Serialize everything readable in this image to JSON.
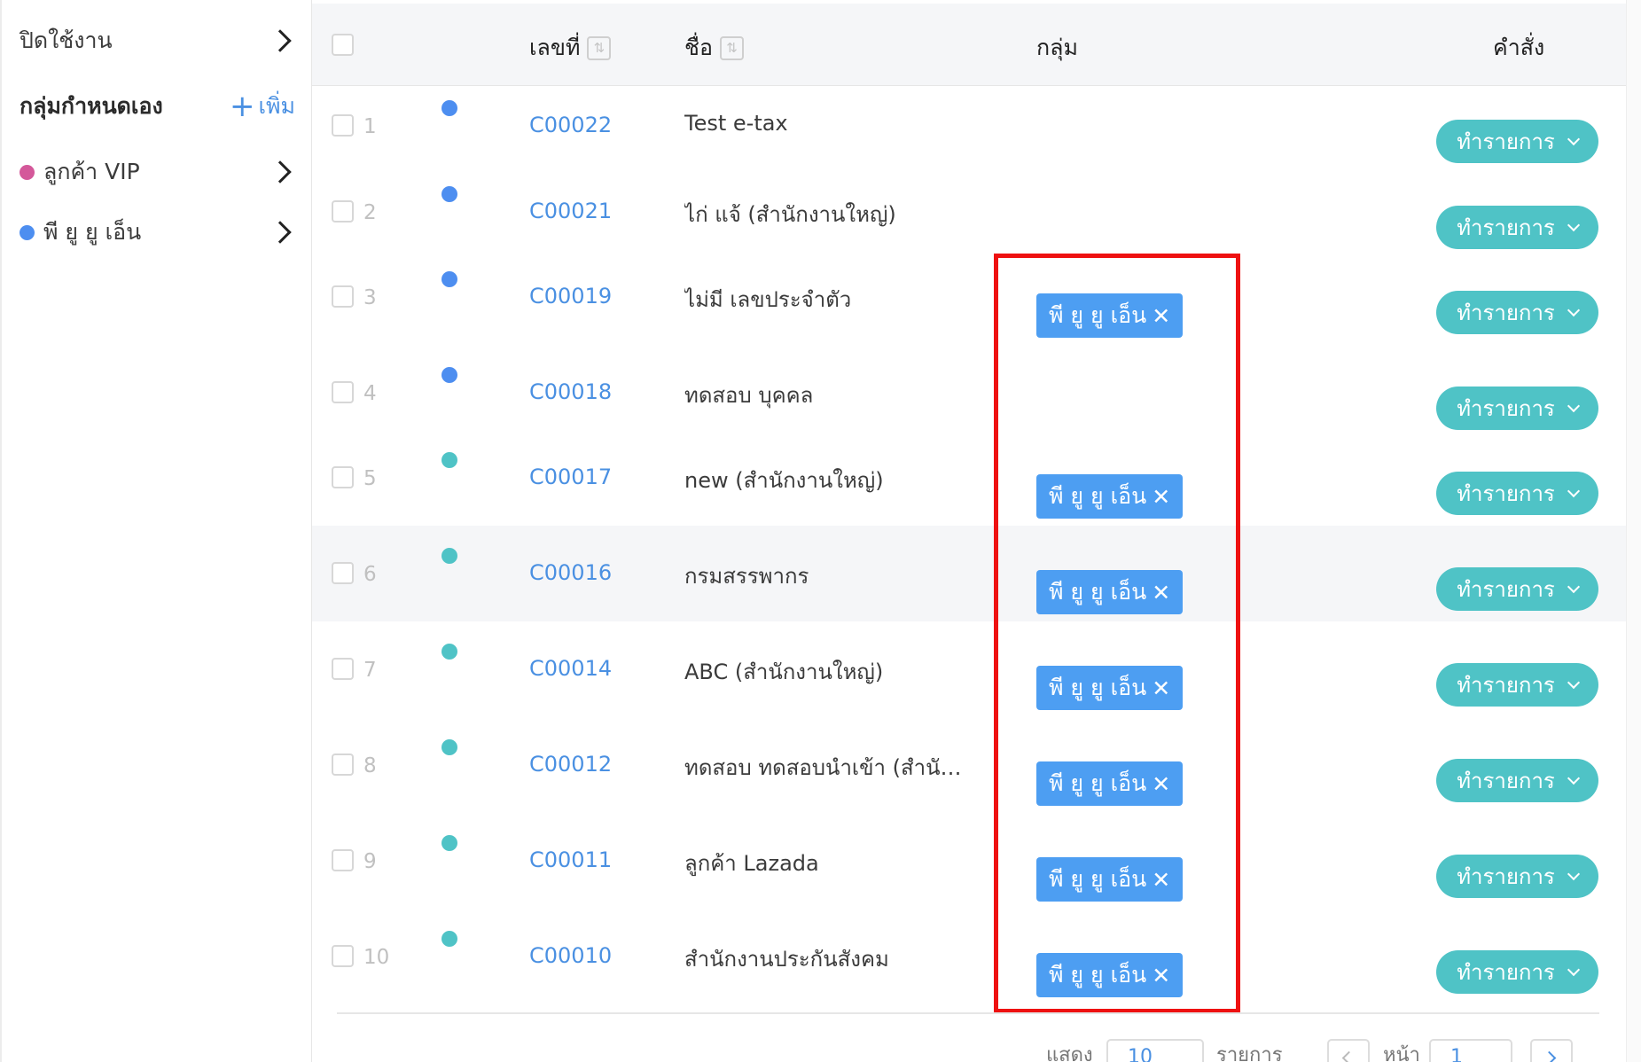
{
  "sidebar": {
    "disabled_label": "ปิดใช้งาน",
    "custom_groups_title": "กลุ่มกำหนดเอง",
    "add_label": "เพิ่ม",
    "groups": [
      {
        "label": "ลูกค้า VIP",
        "color": "#d4589a"
      },
      {
        "label": "พี ยู ยู เอ็น",
        "color": "#4d8ef0"
      }
    ]
  },
  "table": {
    "headers": {
      "code": "เลขที่",
      "name": "ชื่อ",
      "group": "กลุ่ม",
      "command": "คำสั่ง"
    },
    "action_label": "ทำรายการ",
    "tag_label": "พี ยู ยู เอ็น",
    "rows": [
      {
        "num": "1",
        "dot": "#4d8ef0",
        "code": "C00022",
        "name": "Test e-tax",
        "tag": false
      },
      {
        "num": "2",
        "dot": "#4d8ef0",
        "code": "C00021",
        "name": "ไก่ แจ้ (สำนักงานใหญ่)",
        "tag": false
      },
      {
        "num": "3",
        "dot": "#4d8ef0",
        "code": "C00019",
        "name": "ไม่มี เลขประจำตัว",
        "tag": true
      },
      {
        "num": "4",
        "dot": "#4d8ef0",
        "code": "C00018",
        "name": "ทดสอบ บุคคล",
        "tag": false
      },
      {
        "num": "5",
        "dot": "#4fc3c6",
        "code": "C00017",
        "name": "new (สำนักงานใหญ่)",
        "tag": true
      },
      {
        "num": "6",
        "dot": "#4fc3c6",
        "code": "C00016",
        "name": "กรมสรรพากร",
        "tag": true
      },
      {
        "num": "7",
        "dot": "#4fc3c6",
        "code": "C00014",
        "name": "ABC (สำนักงานใหญ่)",
        "tag": true
      },
      {
        "num": "8",
        "dot": "#4fc3c6",
        "code": "C00012",
        "name": "ทดสอบ ทดสอบนำเข้า (สำนักงา...",
        "tag": true
      },
      {
        "num": "9",
        "dot": "#4fc3c6",
        "code": "C00011",
        "name": "ลูกค้า Lazada",
        "tag": true
      },
      {
        "num": "10",
        "dot": "#4fc3c6",
        "code": "C00010",
        "name": "สำนักงานประกันสังคม",
        "tag": true
      }
    ]
  },
  "pagination": {
    "show_label": "แสดง",
    "page_size": "10",
    "items_label": "รายการ",
    "page_label": "หน้า",
    "page": "1"
  }
}
